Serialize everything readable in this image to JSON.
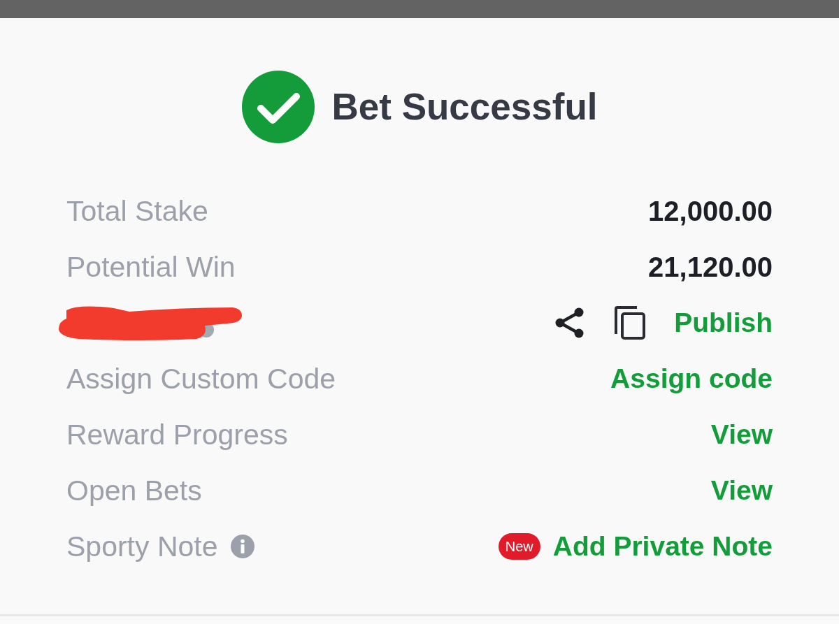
{
  "header": {
    "title": "Bet Successful"
  },
  "rows": [
    {
      "kind": "amount",
      "label": "Total Stake",
      "value": "12,000.00"
    },
    {
      "kind": "amount",
      "label": "Potential Win",
      "value": "21,120.00"
    },
    {
      "kind": "share",
      "link": "Publish"
    },
    {
      "kind": "link",
      "label": "Assign Custom Code",
      "link": "Assign code"
    },
    {
      "kind": "link",
      "label": "Reward Progress",
      "link": "View"
    },
    {
      "kind": "link",
      "label": "Open Bets",
      "link": "View"
    },
    {
      "kind": "note",
      "label": "Sporty Note",
      "badge": "New",
      "link": "Add Private Note"
    }
  ]
}
